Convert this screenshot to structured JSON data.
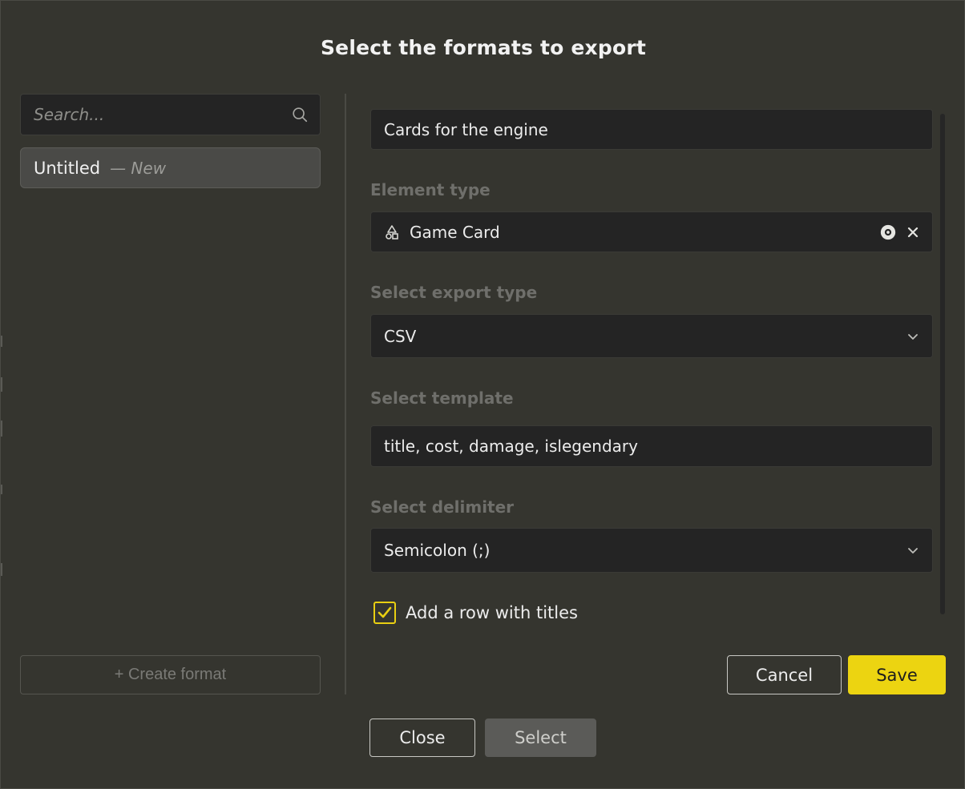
{
  "dialog": {
    "title": "Select the formats to export"
  },
  "sidebar": {
    "search_placeholder": "Search...",
    "items": [
      {
        "name": "Untitled",
        "badge": "— New"
      }
    ],
    "create_label": "+ Create format"
  },
  "form": {
    "format_name": "Cards for the engine",
    "element_type_label": "Element type",
    "element_type_value": "Game Card",
    "export_type_label": "Select export type",
    "export_type_value": "CSV",
    "template_label": "Select template",
    "template_value": "title, cost, damage, islegendary",
    "delimiter_label": "Select delimiter",
    "delimiter_value": "Semicolon (;)",
    "add_titles_label": "Add a row with titles",
    "add_titles_checked": true,
    "cancel_label": "Cancel",
    "save_label": "Save"
  },
  "footer": {
    "close_label": "Close",
    "select_label": "Select"
  },
  "colors": {
    "accent": "#ecd411",
    "background": "#35352f",
    "field": "#242424"
  },
  "icons": {
    "search": "search-icon",
    "element_type": "shapes-icon",
    "preview": "eye-icon",
    "clear": "close-icon",
    "dropdown": "chevron-down-icon",
    "check": "check-icon"
  }
}
